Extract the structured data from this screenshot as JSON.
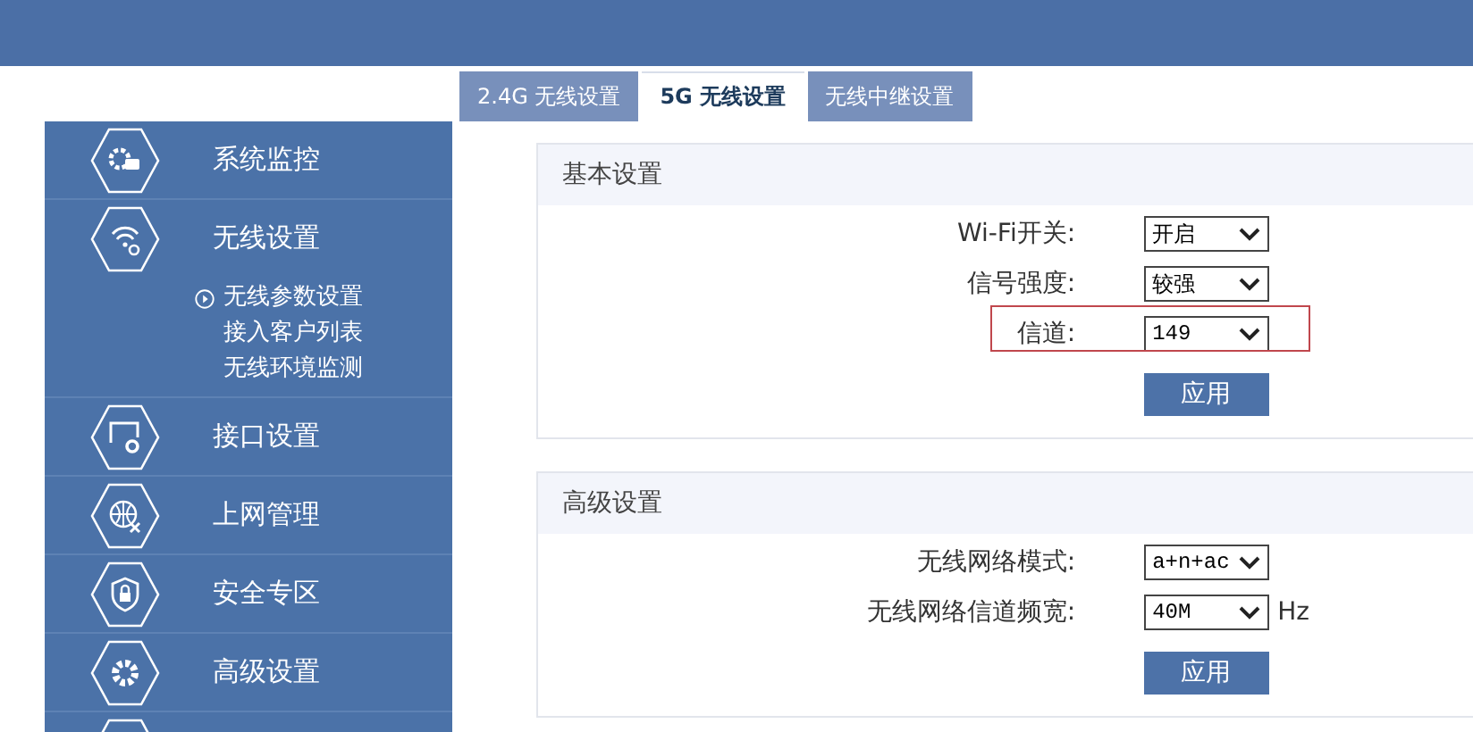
{
  "tabs": [
    {
      "label": "2.4G 无线设置",
      "selected": false
    },
    {
      "label": "5G 无线设置",
      "selected": true
    },
    {
      "label": "无线中继设置",
      "selected": false
    }
  ],
  "sidebar": {
    "items": [
      {
        "label": "系统监控",
        "expanded": false
      },
      {
        "label": "无线设置",
        "expanded": true,
        "children": [
          {
            "label": "无线参数设置",
            "selected": true
          },
          {
            "label": "接入客户列表",
            "selected": false
          },
          {
            "label": "无线环境监测",
            "selected": false
          }
        ]
      },
      {
        "label": "接口设置",
        "expanded": false
      },
      {
        "label": "上网管理",
        "expanded": false
      },
      {
        "label": "安全专区",
        "expanded": false
      },
      {
        "label": "高级设置",
        "expanded": false
      },
      {
        "expanded": false
      }
    ]
  },
  "sections": [
    {
      "title": "基本设置",
      "rows": [
        {
          "label": "Wi-Fi开关:",
          "value": "开启",
          "highlighted": false
        },
        {
          "label": "信号强度:",
          "value": "较强",
          "highlighted": false
        },
        {
          "label": "信道:",
          "value": "149",
          "highlighted": true
        }
      ],
      "button": "应用"
    },
    {
      "title": "高级设置",
      "rows": [
        {
          "label": "无线网络模式:",
          "value": "a+n+ac",
          "highlighted": false
        },
        {
          "label": "无线网络信道频宽:",
          "value": "40M",
          "unit": "Hz",
          "highlighted": false
        }
      ],
      "button": "应用"
    }
  ]
}
